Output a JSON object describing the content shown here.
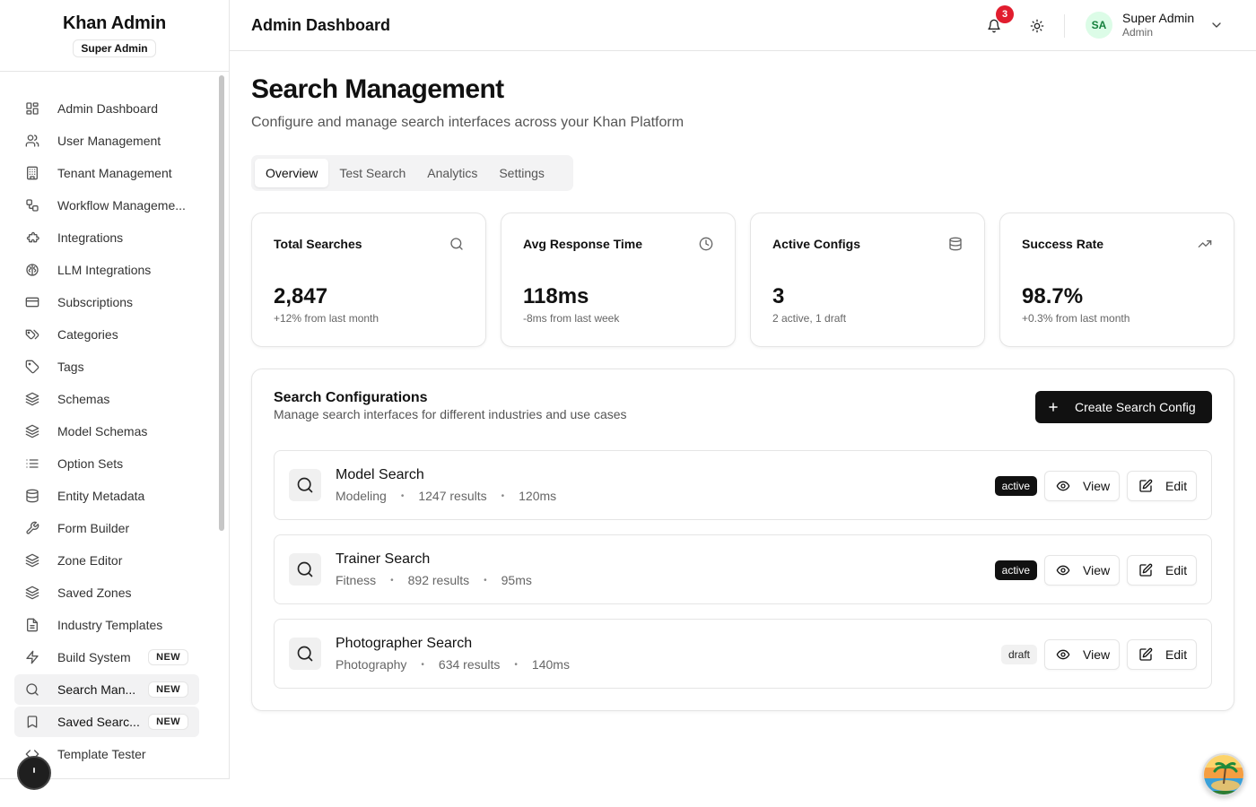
{
  "sidebar": {
    "brand_title": "Khan Admin",
    "brand_badge": "Super Admin",
    "items": [
      {
        "label": "Admin Dashboard",
        "icon": "dashboard-icon"
      },
      {
        "label": "User Management",
        "icon": "users-icon"
      },
      {
        "label": "Tenant Management",
        "icon": "building-icon"
      },
      {
        "label": "Workflow Manageme...",
        "icon": "workflow-icon"
      },
      {
        "label": "Integrations",
        "icon": "puzzle-icon"
      },
      {
        "label": "LLM Integrations",
        "icon": "brain-icon"
      },
      {
        "label": "Subscriptions",
        "icon": "credit-card-icon"
      },
      {
        "label": "Categories",
        "icon": "tags-icon"
      },
      {
        "label": "Tags",
        "icon": "tag-icon"
      },
      {
        "label": "Schemas",
        "icon": "layers-icon"
      },
      {
        "label": "Model Schemas",
        "icon": "layers-icon"
      },
      {
        "label": "Option Sets",
        "icon": "list-icon"
      },
      {
        "label": "Entity Metadata",
        "icon": "database-icon"
      },
      {
        "label": "Form Builder",
        "icon": "wrench-icon"
      },
      {
        "label": "Zone Editor",
        "icon": "layers-icon"
      },
      {
        "label": "Saved Zones",
        "icon": "layers-icon"
      },
      {
        "label": "Industry Templates",
        "icon": "file-icon"
      },
      {
        "label": "Build System",
        "icon": "zap-icon",
        "badge": "NEW"
      },
      {
        "label": "Search Man...",
        "icon": "search-icon",
        "badge": "NEW",
        "active": true
      },
      {
        "label": "Saved Searc...",
        "icon": "bookmark-icon",
        "badge": "NEW",
        "active": true
      },
      {
        "label": "Template Tester",
        "icon": "code-icon"
      }
    ]
  },
  "topbar": {
    "title": "Admin Dashboard",
    "notification_count": "3",
    "user_initials": "SA",
    "user_name": "Super Admin",
    "user_role": "Admin"
  },
  "page": {
    "title": "Search Management",
    "subtitle": "Configure and manage search interfaces across your Khan Platform"
  },
  "tabs": [
    {
      "label": "Overview",
      "active": true
    },
    {
      "label": "Test Search"
    },
    {
      "label": "Analytics"
    },
    {
      "label": "Settings"
    }
  ],
  "stats": [
    {
      "label": "Total Searches",
      "value": "2,847",
      "sub": "+12% from last month",
      "icon": "search-icon"
    },
    {
      "label": "Avg Response Time",
      "value": "118ms",
      "sub": "-8ms from last week",
      "icon": "clock-icon"
    },
    {
      "label": "Active Configs",
      "value": "3",
      "sub": "2 active, 1 draft",
      "icon": "database-icon"
    },
    {
      "label": "Success Rate",
      "value": "98.7%",
      "sub": "+0.3% from last month",
      "icon": "trending-up-icon"
    }
  ],
  "configs": {
    "title": "Search Configurations",
    "description": "Manage search interfaces for different industries and use cases",
    "create_label": "Create Search Config",
    "view_label": "View",
    "edit_label": "Edit",
    "dot": "•",
    "rows": [
      {
        "name": "Model Search",
        "industry": "Modeling",
        "results": "1247 results",
        "time": "120ms",
        "status": "active"
      },
      {
        "name": "Trainer Search",
        "industry": "Fitness",
        "results": "892 results",
        "time": "95ms",
        "status": "active"
      },
      {
        "name": "Photographer Search",
        "industry": "Photography",
        "results": "634 results",
        "time": "140ms",
        "status": "draft"
      }
    ]
  },
  "colors": {
    "primary": "#111111",
    "notification": "#e11d2e",
    "avatar_bg": "#dcfce7",
    "avatar_fg": "#15803d"
  }
}
